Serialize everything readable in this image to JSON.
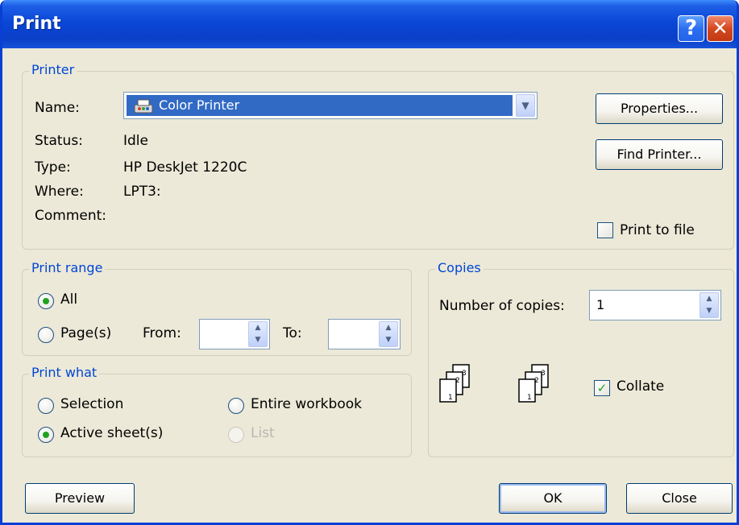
{
  "window": {
    "title": "Print"
  },
  "printer": {
    "legend": "Printer",
    "name_label": "Name:",
    "name_value": "Color Printer",
    "status_label": "Status:",
    "status_value": "Idle",
    "type_label": "Type:",
    "type_value": "HP DeskJet 1220C",
    "where_label": "Where:",
    "where_value": "LPT3:",
    "comment_label": "Comment:",
    "properties_button": "Properties...",
    "find_printer_button": "Find Printer...",
    "print_to_file_label": "Print to file",
    "print_to_file_checked": false
  },
  "print_range": {
    "legend": "Print range",
    "all_label": "All",
    "pages_label": "Page(s)",
    "from_label": "From:",
    "to_label": "To:",
    "from_value": "",
    "to_value": "",
    "selected": "All"
  },
  "print_what": {
    "legend": "Print what",
    "selection_label": "Selection",
    "entire_workbook_label": "Entire workbook",
    "active_sheets_label": "Active sheet(s)",
    "list_label": "List",
    "selected": "Active sheet(s)"
  },
  "copies": {
    "legend": "Copies",
    "number_label": "Number of copies:",
    "number_value": "1",
    "collate_label": "Collate",
    "collate_checked": true
  },
  "buttons": {
    "preview": "Preview",
    "ok": "OK",
    "close": "Close"
  },
  "icons": [
    "help-icon",
    "close-icon",
    "printer-icon",
    "chevron-down-icon",
    "collate-pages-icon"
  ]
}
